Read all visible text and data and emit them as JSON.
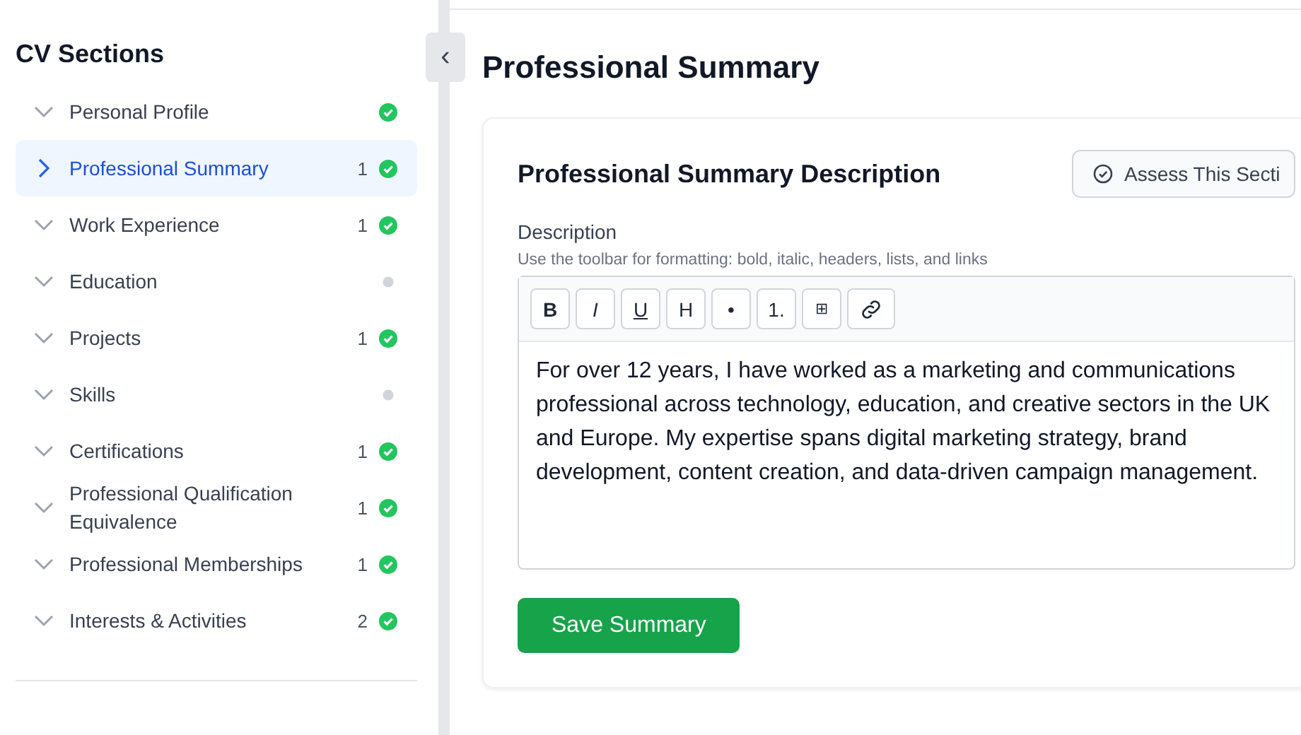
{
  "sidebar": {
    "title": "CV Sections",
    "collapse_button": "‹",
    "items": [
      {
        "label": "Personal Profile",
        "selected": false,
        "completed": true
      },
      {
        "label": "Professional Summary",
        "selected": true,
        "count": "1",
        "completed": true
      },
      {
        "label": "Work Experience",
        "selected": false,
        "count": "1",
        "completed": true
      },
      {
        "label": "Education",
        "selected": false,
        "completed": false
      },
      {
        "label": "Projects",
        "selected": false,
        "count": "1",
        "completed": true
      },
      {
        "label": "Skills",
        "selected": false,
        "completed": false
      },
      {
        "label": "Certifications",
        "selected": false,
        "count": "1",
        "completed": true
      },
      {
        "label": "Professional Qualification Equivalence",
        "selected": false,
        "count": "1",
        "completed": true
      },
      {
        "label": "Professional Memberships",
        "selected": false,
        "count": "1",
        "completed": true
      },
      {
        "label": "Interests & Activities",
        "selected": false,
        "count": "2",
        "completed": true
      }
    ]
  },
  "main": {
    "title": "Professional Summary",
    "card": {
      "title": "Professional Summary Description",
      "assess_button": "Assess This Secti",
      "field_label": "Description",
      "hint": "Use the toolbar for formatting: bold, italic, headers, lists, and links",
      "toolbar": [
        {
          "kind": "bold",
          "label": "B"
        },
        {
          "kind": "italic",
          "label": "I"
        },
        {
          "kind": "underline",
          "label": "U"
        },
        {
          "kind": "plain",
          "label": "H"
        },
        {
          "kind": "plain",
          "label": "•"
        },
        {
          "kind": "plain",
          "label": "1."
        },
        {
          "kind": "small",
          "label": "⊞"
        },
        {
          "kind": "link"
        }
      ],
      "value": "For over 12 years, I have worked as a marketing and communications professional across technology, education, and creative sectors in the UK and Europe. My expertise spans digital marketing strategy, brand development, content creation, and data-driven campaign management.",
      "save_button": "Save Summary"
    }
  }
}
